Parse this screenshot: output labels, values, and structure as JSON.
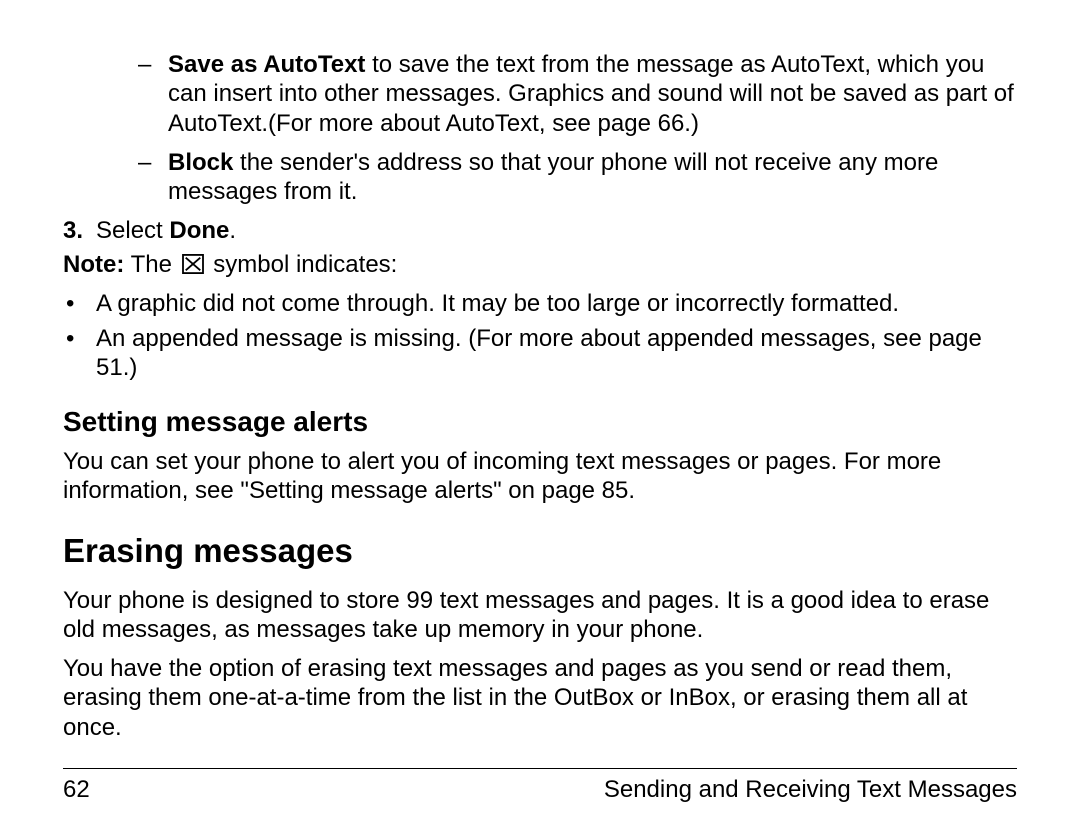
{
  "sublist": [
    {
      "bold": "Save as AutoText",
      "rest": " to save the text from the message as AutoText, which you can insert into other messages. Graphics and sound will not be saved as part of AutoText.(For more about AutoText, see page 66.)"
    },
    {
      "bold": "Block",
      "rest": " the sender's address so that your phone will not receive any more messages from it."
    }
  ],
  "step3": {
    "num": "3.",
    "pre": "Select ",
    "bold": "Done",
    "post": "."
  },
  "note": {
    "label": "Note:",
    "pre": " The ",
    "post": " symbol indicates:"
  },
  "bullets": [
    "A graphic did not come through. It may be too large or incorrectly formatted.",
    "An appended message is missing. (For more about appended messages, see page 51.)"
  ],
  "subheading": "Setting message alerts",
  "sub_para": "You can set your phone to alert you of incoming text messages or pages. For more information, see \"Setting message alerts\" on page 85.",
  "heading": "Erasing messages",
  "para1": "Your phone is designed to store 99 text messages and pages. It is a good idea to erase old messages, as messages take up memory in your phone.",
  "para2": "You have the option of erasing text messages and pages as you send or read them, erasing them one-at-a-time from the list in the OutBox or InBox, or erasing them all at once.",
  "footer": {
    "page": "62",
    "title": "Sending and Receiving Text Messages"
  }
}
